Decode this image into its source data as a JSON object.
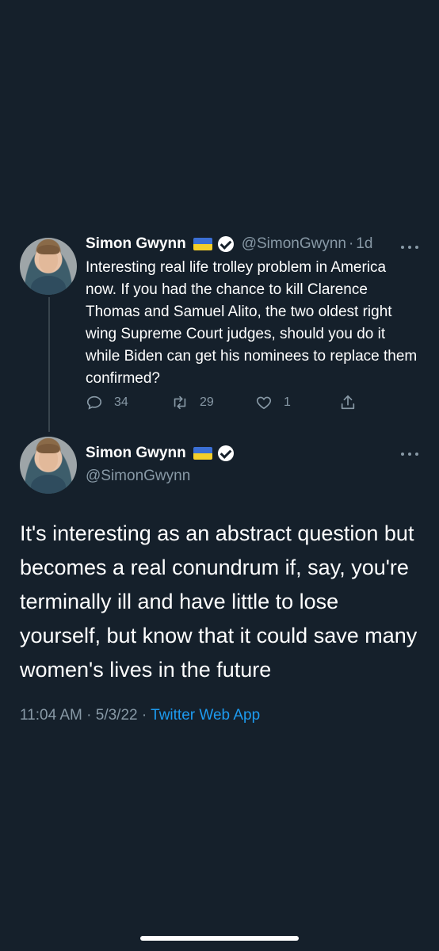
{
  "parent_tweet": {
    "author_name": "Simon Gwynn",
    "handle": "@SimonGwynn",
    "separator": "·",
    "age": "1d",
    "text": "Interesting real life trolley problem in America now. If you had the chance to kill Clarence Thomas and Samuel Alito, the two oldest right wing Supreme Court judges, should you do it while Biden can get his nominees to replace them confirmed?",
    "reply_count": "34",
    "retweet_count": "29",
    "like_count": "1"
  },
  "main_tweet": {
    "author_name": "Simon Gwynn",
    "handle": "@SimonGwynn",
    "text": "It's interesting as an abstract question but becomes a real conundrum if, say, you're terminally ill and have little to lose yourself, but know that it could save many women's lives in the future",
    "time": "11:04 AM",
    "date": "5/3/22",
    "separator": "·",
    "source": "Twitter Web App"
  },
  "icons": {
    "flag": "ukraine-flag-icon",
    "verified": "verified-badge-icon",
    "more": "more-options-icon",
    "reply": "reply-icon",
    "retweet": "retweet-icon",
    "like": "heart-icon",
    "share": "share-icon"
  },
  "colors": {
    "background": "#15202b",
    "primary_text": "#ffffff",
    "secondary_text": "#8899a6",
    "link": "#1d9bf0",
    "thread_line": "#38444d"
  }
}
